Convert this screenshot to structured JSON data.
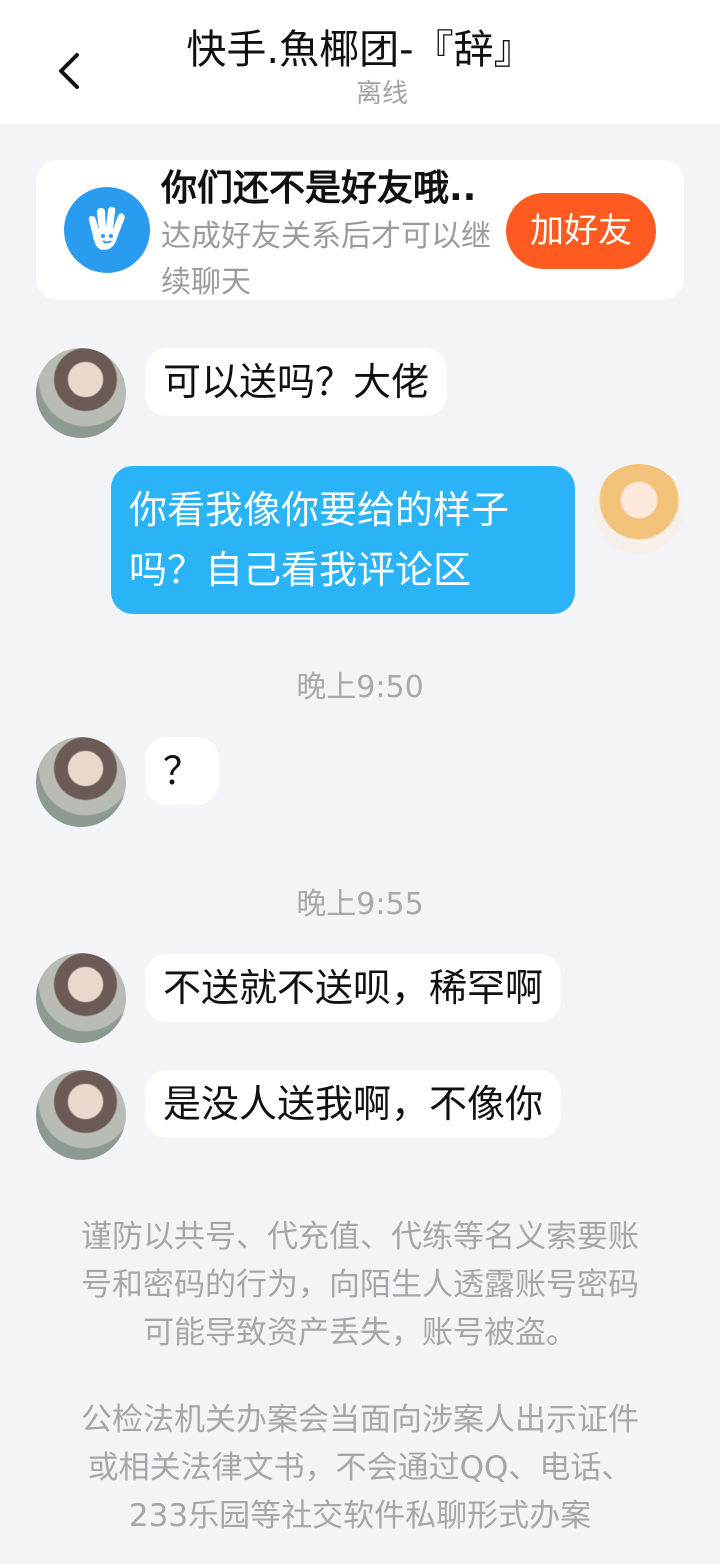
{
  "header": {
    "title": "快手.魚椰团-『辞』",
    "status": "离线"
  },
  "friend_card": {
    "title": "你们还不是好友哦..",
    "description": "达成好友关系后才可以继续聊天",
    "add_button": "加好友"
  },
  "messages": [
    {
      "side": "in",
      "text": "可以送吗？大佬"
    },
    {
      "side": "out",
      "text": "你看我像你要给的样子吗？自己看我评论区"
    },
    {
      "side": "in",
      "text": "？"
    },
    {
      "side": "in",
      "text": "不送就不送呗，稀罕啊"
    },
    {
      "side": "in",
      "text": "是没人送我啊，不像你"
    }
  ],
  "timestamps": [
    "晚上9:50",
    "晚上9:55"
  ],
  "notices": [
    "谨防以共号、代充值、代练等名义索要账号和密码的行为，向陌生人透露账号密码可能导致资产丢失，账号被盗。",
    "公检法机关办案会当面向涉案人出示证件或相关法律文书，不会通过QQ、电话、233乐园等社交软件私聊形式办案"
  ],
  "colors": {
    "accent_blue": "#2ab4f7",
    "add_orange": "#ff5a1f",
    "background": "#f2f4f7"
  },
  "icons": [
    "back-arrow-icon",
    "hand-icon"
  ]
}
